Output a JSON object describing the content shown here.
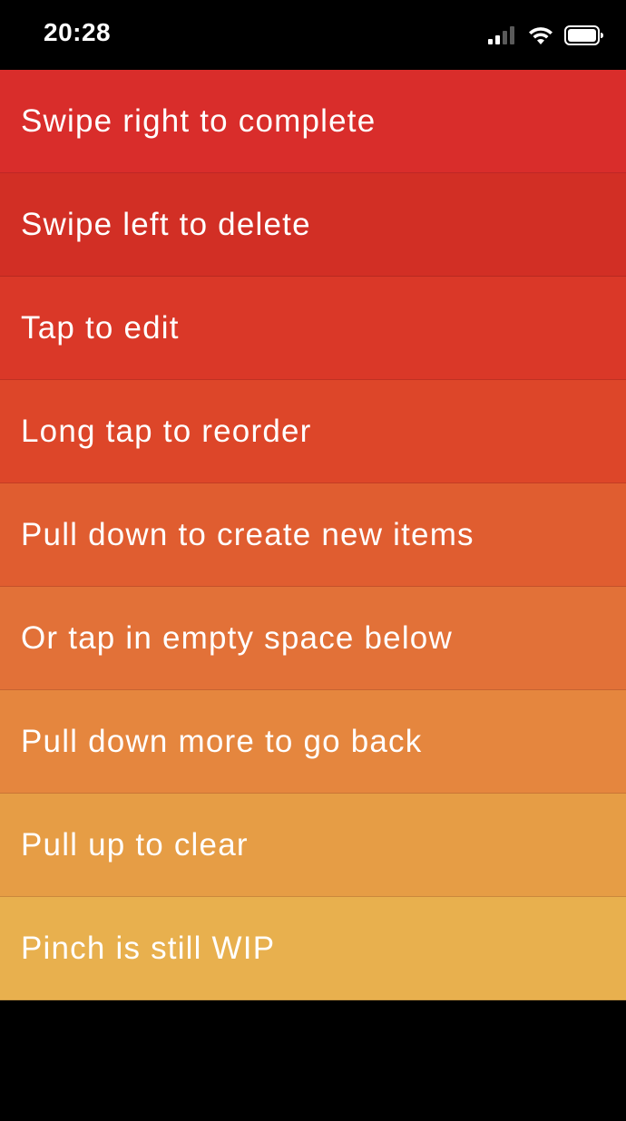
{
  "status_bar": {
    "time": "20:28",
    "icons": [
      "cellular-signal-icon",
      "wifi-icon",
      "battery-icon"
    ]
  },
  "todo_list": {
    "items": [
      {
        "label": "Swipe right to complete",
        "color": "#d92d2b"
      },
      {
        "label": "Swipe left to delete",
        "color": "#d22f25"
      },
      {
        "label": "Tap to edit",
        "color": "#da3828"
      },
      {
        "label": "Long tap to reorder",
        "color": "#dd4629"
      },
      {
        "label": "Pull down to create new items",
        "color": "#e05d30"
      },
      {
        "label": "Or tap in empty space below",
        "color": "#e27138"
      },
      {
        "label": "Pull down more to go back",
        "color": "#e5863e"
      },
      {
        "label": "Pull up to clear",
        "color": "#e69d45"
      },
      {
        "label": "Pinch is still WIP",
        "color": "#e8b04e"
      }
    ]
  }
}
